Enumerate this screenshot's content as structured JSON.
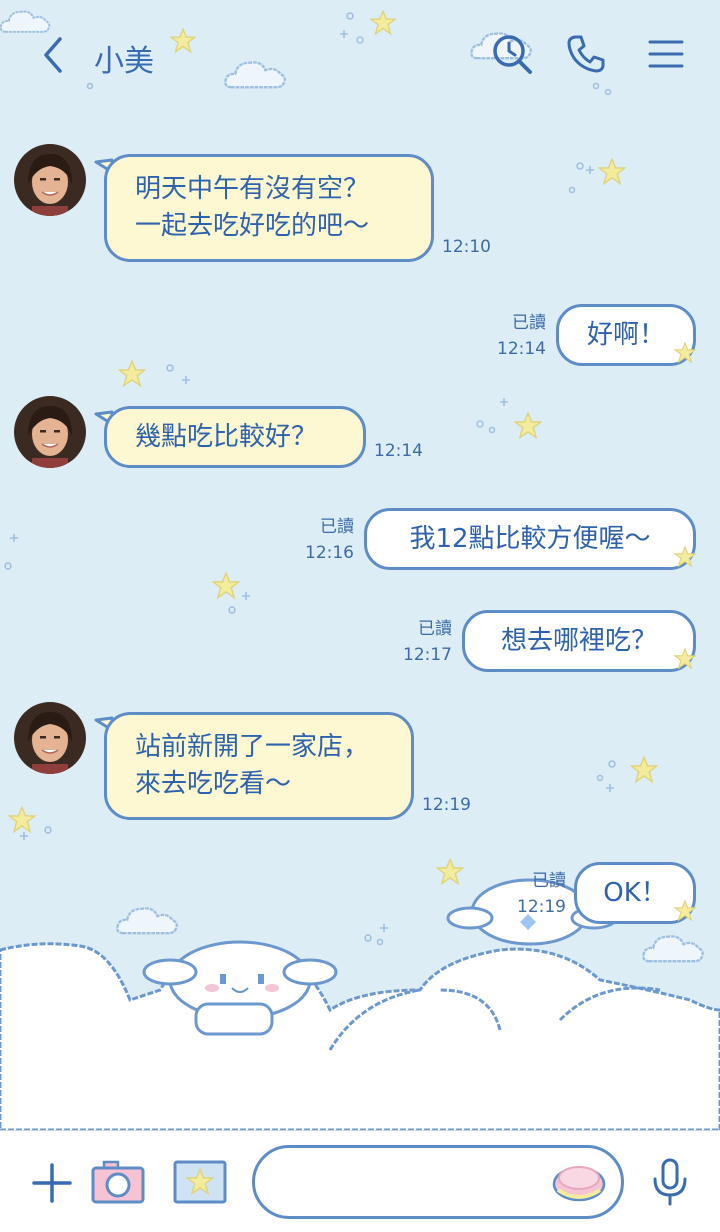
{
  "header": {
    "title": "小美"
  },
  "messages": [
    {
      "direction": "in",
      "text": "明天中午有沒有空？\n一起去吃好吃的吧～",
      "time": "12:10"
    },
    {
      "direction": "out",
      "text": "好啊！",
      "read": "已讀",
      "time": "12:14"
    },
    {
      "direction": "in",
      "text": "幾點吃比較好？",
      "time": "12:14"
    },
    {
      "direction": "out",
      "text": "我12點比較方便喔～",
      "read": "已讀",
      "time": "12:16"
    },
    {
      "direction": "out",
      "text": "想去哪裡吃？",
      "read": "已讀",
      "time": "12:17"
    },
    {
      "direction": "in",
      "text": "站前新開了一家店，\n來去吃吃看～",
      "time": "12:19"
    },
    {
      "direction": "out",
      "text": "OK！",
      "read": "已讀",
      "time": "12:19"
    }
  ],
  "input": {
    "placeholder": ""
  },
  "colors": {
    "background": "#dcedf6",
    "accent": "#3a6ab0",
    "incoming_bubble": "#fdf8d2",
    "outgoing_bubble": "#ffffff",
    "bubble_border": "#5d8cc6",
    "star": "#f3ec9c"
  },
  "icons": [
    "back-icon",
    "search-clock-icon",
    "phone-icon",
    "menu-icon",
    "plus-icon",
    "camera-icon",
    "photo-icon",
    "sticker-icon",
    "mic-icon"
  ]
}
